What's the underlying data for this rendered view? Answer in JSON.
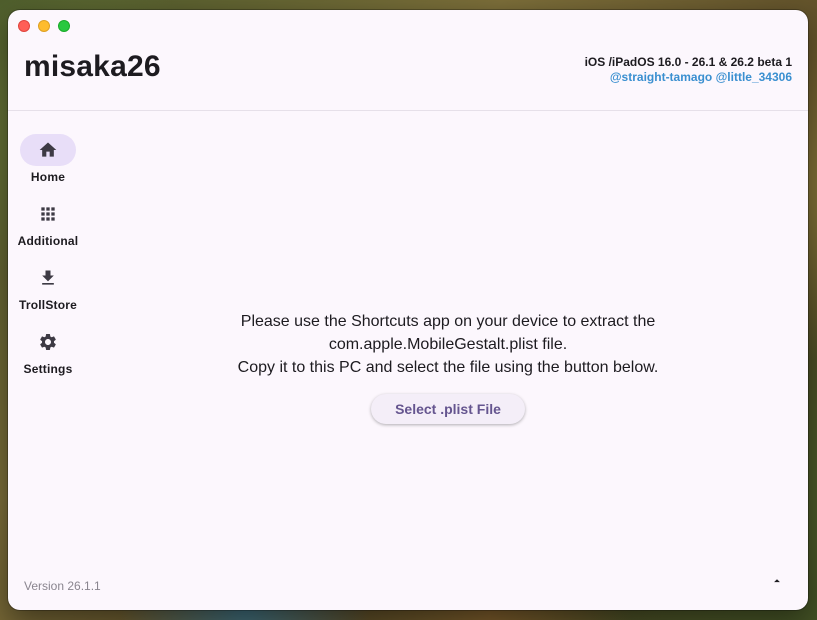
{
  "window": {
    "app_title": "misaka26",
    "version_range": "iOS /iPadOS 16.0 - 26.1 & 26.2 beta 1",
    "credits": [
      "@straight-tamago",
      "@little_34306"
    ]
  },
  "sidebar": {
    "items": [
      {
        "label": "Home",
        "icon": "home-icon",
        "active": true
      },
      {
        "label": "Additional",
        "icon": "grid-icon",
        "active": false
      },
      {
        "label": "TrollStore",
        "icon": "download-icon",
        "active": false
      },
      {
        "label": "Settings",
        "icon": "gear-icon",
        "active": false
      }
    ]
  },
  "main": {
    "instructions": [
      "Please use the Shortcuts app on your device to extract the",
      "com.apple.MobileGestalt.plist file.",
      "Copy it to this PC and select the file using the button below."
    ],
    "select_button_label": "Select .plist File"
  },
  "footer": {
    "version": "Version 26.1.1",
    "scroll_icon": "arrow-up-icon"
  },
  "colors": {
    "accent": "#65558f",
    "nav_active": "#e8def8",
    "link": "#3a8fd0",
    "window_bg": "#fcf7fd"
  }
}
